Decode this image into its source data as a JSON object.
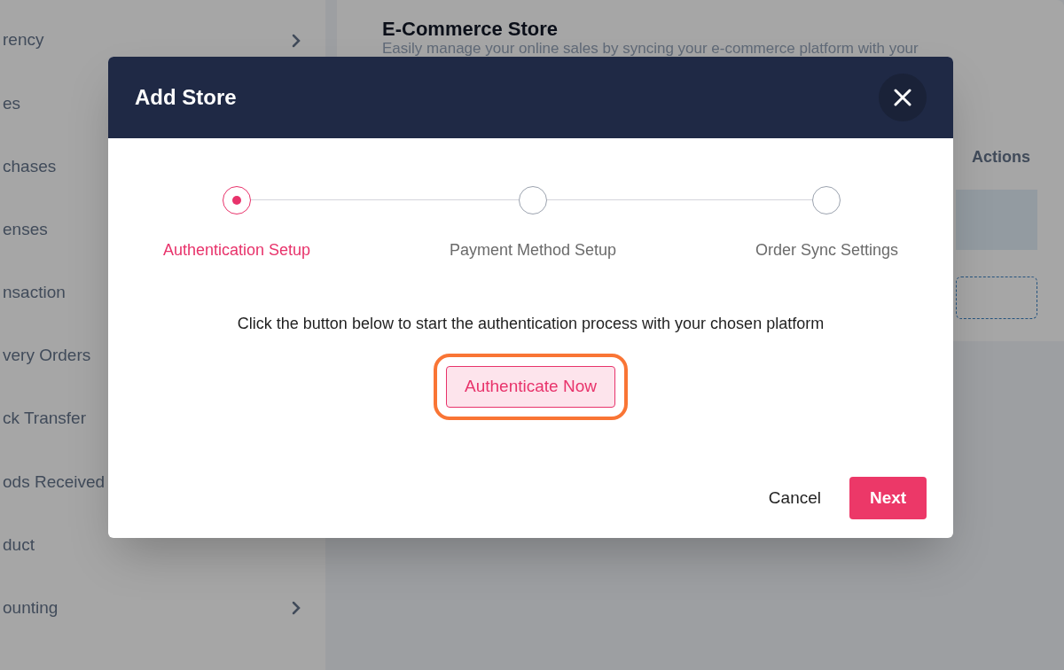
{
  "sidebar": {
    "items": [
      {
        "label": "rency",
        "has_submenu": true
      },
      {
        "label": "es",
        "has_submenu": false
      },
      {
        "label": "chases",
        "has_submenu": false
      },
      {
        "label": "enses",
        "has_submenu": false
      },
      {
        "label": "nsaction",
        "has_submenu": false
      },
      {
        "label": "very Orders",
        "has_submenu": false
      },
      {
        "label": "ck Transfer",
        "has_submenu": false
      },
      {
        "label": "ods Received",
        "has_submenu": false
      },
      {
        "label": "duct",
        "has_submenu": false
      },
      {
        "label": "ounting",
        "has_submenu": true
      }
    ]
  },
  "page": {
    "title": "E-Commerce Store",
    "subtitle": "Easily manage your online sales by syncing your e-commerce platform with your",
    "table": {
      "column_header": "Actions"
    }
  },
  "dialog": {
    "title": "Add Store",
    "steps": [
      {
        "label": "Authentication Setup",
        "selected": true
      },
      {
        "label": "Payment Method Setup",
        "selected": false
      },
      {
        "label": "Order Sync Settings",
        "selected": false
      }
    ],
    "message": "Click the button below to start the authentication process with your chosen platform",
    "auth_button": "Authenticate Now",
    "cancel_button": "Cancel",
    "next_button": "Next"
  }
}
